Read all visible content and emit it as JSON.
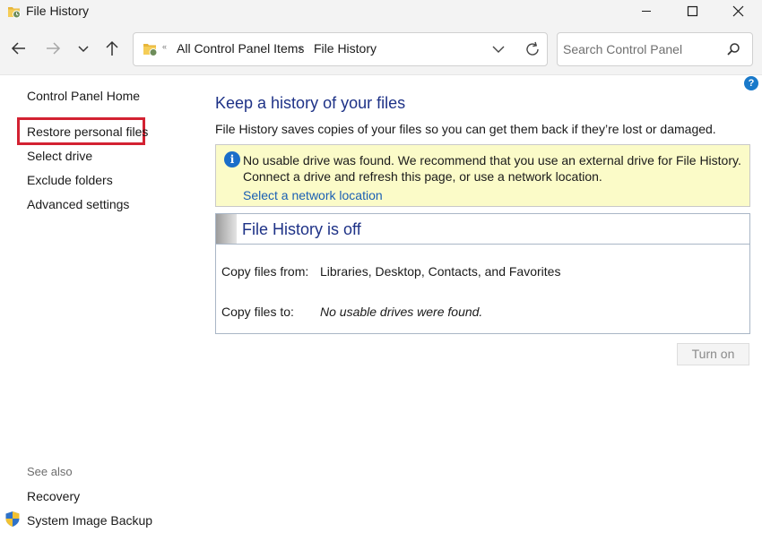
{
  "window": {
    "title": "File History"
  },
  "address_bar": {
    "more": "«",
    "crumbs": [
      "All Control Panel Items",
      "File History"
    ],
    "separator": "›"
  },
  "search": {
    "placeholder": "Search Control Panel"
  },
  "help": {
    "glyph": "?"
  },
  "sidebar": {
    "items": [
      {
        "label": "Control Panel Home"
      },
      {
        "label": "Restore personal files"
      },
      {
        "label": "Select drive"
      },
      {
        "label": "Exclude folders"
      },
      {
        "label": "Advanced settings"
      }
    ],
    "see_also": {
      "label": "See also",
      "items": [
        {
          "label": "Recovery"
        },
        {
          "label": "System Image Backup"
        }
      ]
    },
    "highlight_color": "#d32232"
  },
  "main": {
    "title": "Keep a history of your files",
    "description": "File History saves copies of your files so you can get them back if they’re lost or damaged.",
    "info": {
      "icon": "i",
      "line1": "No usable drive was found. We recommend that you use an external drive for File History.",
      "line2": "Connect a drive and refresh this page, or use a network location.",
      "link": "Select a network location"
    },
    "panel": {
      "status": "File History is off",
      "rows": [
        {
          "label": "Copy files from:",
          "value": "Libraries, Desktop, Contacts, and Favorites"
        },
        {
          "label": "Copy files to:",
          "value": "No usable drives were found."
        }
      ]
    },
    "turn_on_label": "Turn on"
  },
  "icons": {
    "title": "file-history-icon",
    "back": "back-arrow-icon",
    "forward": "forward-arrow-icon",
    "recent": "chevron-down-icon",
    "up": "up-arrow-icon",
    "address": "control-panel-icon",
    "dropdown": "chevron-down-icon",
    "refresh": "refresh-icon",
    "search": "search-icon",
    "shield": "shield-icon"
  },
  "colors": {
    "heading": "#1e3287",
    "link": "#1a5fb4",
    "info_background": "#fbfbc8",
    "info_icon": "#1a6ec9"
  }
}
